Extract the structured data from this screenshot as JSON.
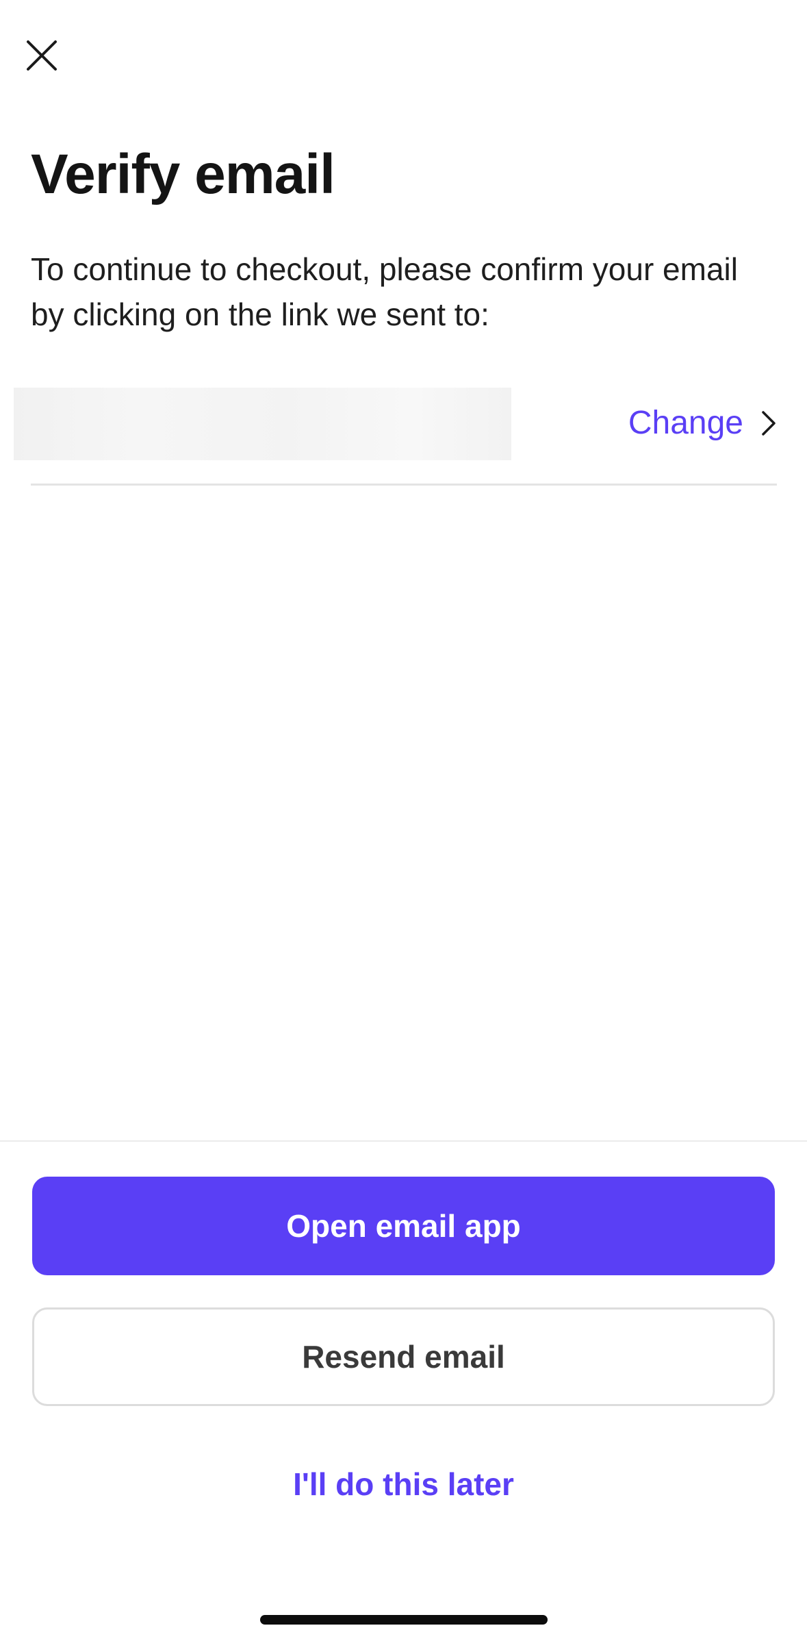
{
  "header": {
    "close_icon": "close-icon"
  },
  "main": {
    "title": "Verify email",
    "description": "To continue to checkout, please confirm your email by clicking on the link we sent to:",
    "email_redacted": true,
    "change_label": "Change",
    "change_icon": "chevron-right-icon"
  },
  "actions": {
    "open_email_label": "Open email app",
    "resend_label": "Resend email",
    "later_label": "I'll do this later"
  },
  "colors": {
    "accent": "#5a3ff5",
    "text": "#141414",
    "divider": "#e4e4e4",
    "secondary_border": "#dcdcdc",
    "background": "#ffffff"
  }
}
